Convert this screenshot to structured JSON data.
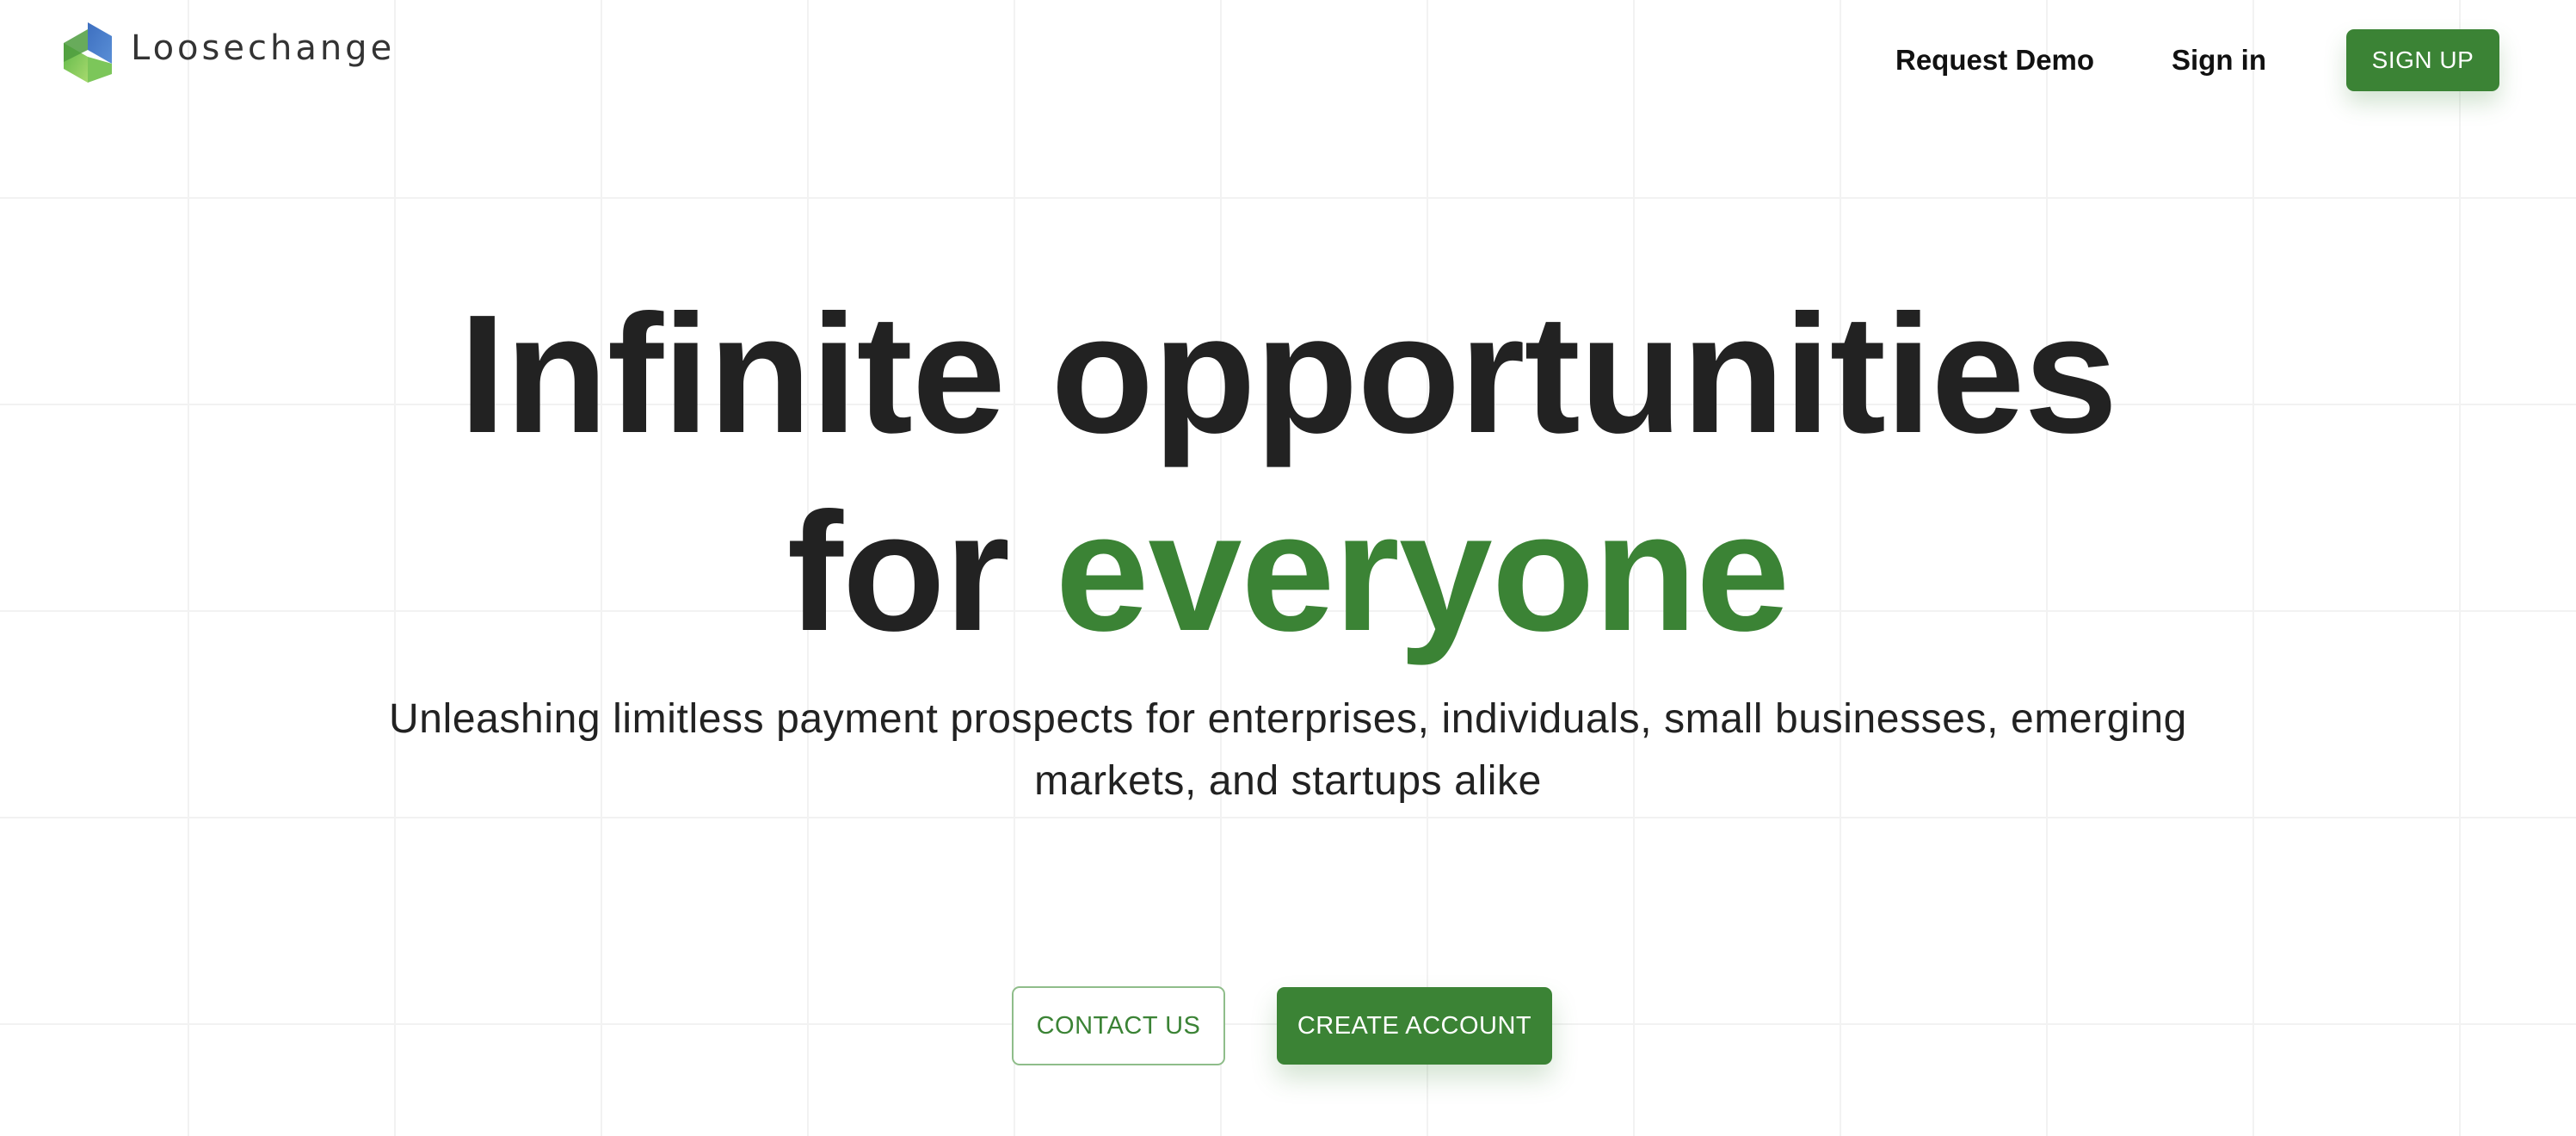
{
  "brand": {
    "name": "Loosechange",
    "logo_icon": "loosechange-logo-icon",
    "logo_colors": [
      "#4a7fc4",
      "#5fb848",
      "#a7d96e"
    ]
  },
  "nav": {
    "request_demo": "Request Demo",
    "sign_in": "Sign in",
    "sign_up": "SIGN UP"
  },
  "hero": {
    "title_line1": "Infinite opportunities",
    "title_line2_prefix": "for",
    "title_line2_accent": "everyone",
    "subtitle": "Unleashing limitless payment prospects for enterprises, individuals, small businesses, emerging markets, and startups alike"
  },
  "cta": {
    "contact": "CONTACT US",
    "create_account": "CREATE ACCOUNT"
  },
  "colors": {
    "accent": "#3b8335",
    "text": "#222222",
    "grid_line": "#f2f2f2",
    "background": "#ffffff"
  }
}
